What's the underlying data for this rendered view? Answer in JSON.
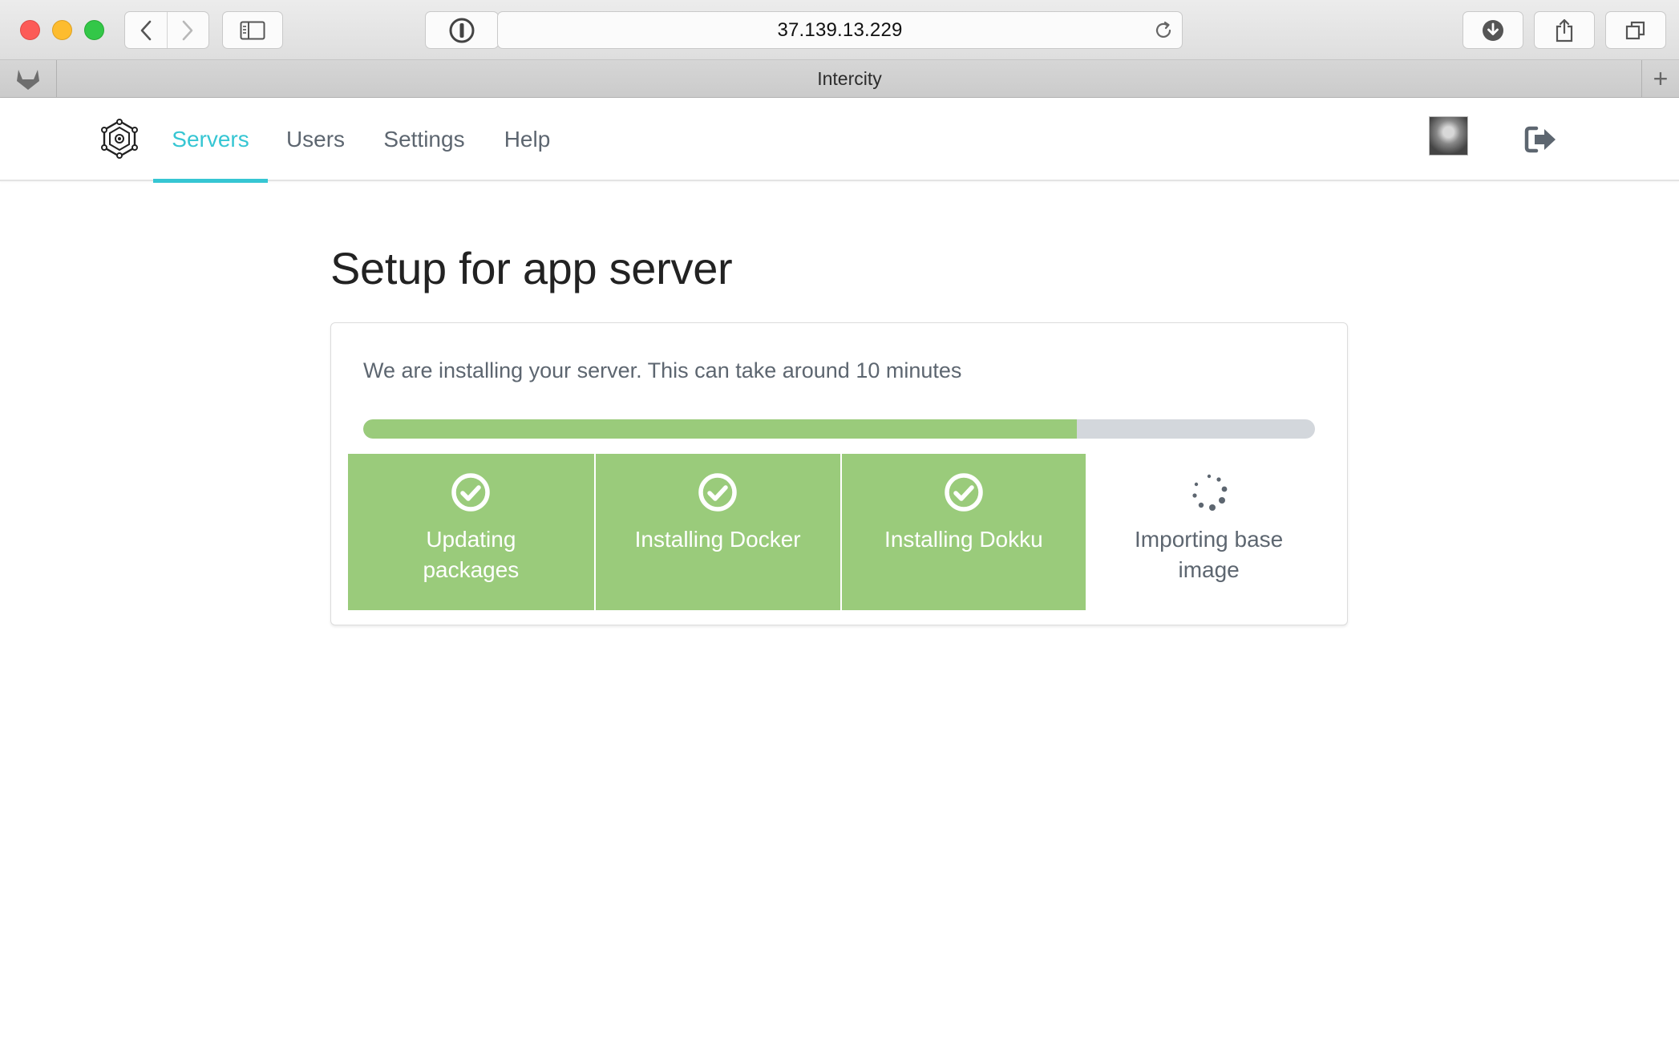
{
  "browser": {
    "url": "37.139.13.229",
    "tab_title": "Intercity",
    "new_tab_label": "+"
  },
  "nav": {
    "items": [
      {
        "label": "Servers",
        "active": true
      },
      {
        "label": "Users",
        "active": false
      },
      {
        "label": "Settings",
        "active": false
      },
      {
        "label": "Help",
        "active": false
      }
    ]
  },
  "page": {
    "title": "Setup for app server",
    "message": "We are installing your server. This can take around 10 minutes",
    "progress_percent": 75
  },
  "steps": [
    {
      "label": "Updating packages",
      "status": "done",
      "icon": "check-circle-icon"
    },
    {
      "label": "Installing Docker",
      "status": "done",
      "icon": "check-circle-icon"
    },
    {
      "label": "Installing Dokku",
      "status": "done",
      "icon": "check-circle-icon"
    },
    {
      "label": "Importing base image",
      "status": "in-progress",
      "icon": "spinner-icon"
    }
  ],
  "colors": {
    "accent": "#36c6d3",
    "success": "#9acb7b",
    "progress_track": "#d3d7dc",
    "text_muted": "#5d6670"
  }
}
